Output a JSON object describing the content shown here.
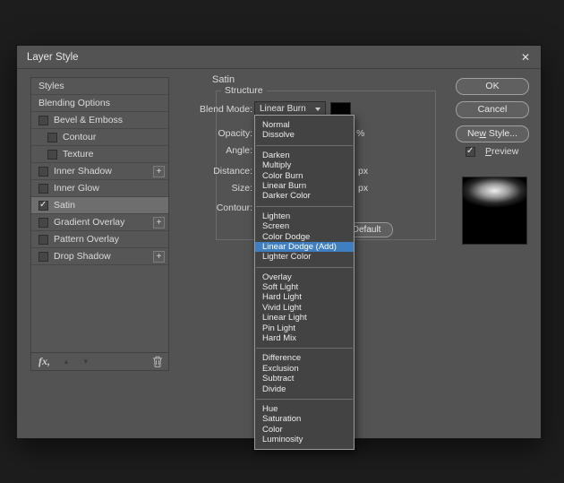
{
  "window": {
    "title": "Layer Style",
    "close_icon": "✕"
  },
  "sidebar": {
    "plus_icon": "+",
    "items": [
      {
        "label": "Styles"
      },
      {
        "label": "Blending Options"
      },
      {
        "label": "Bevel & Emboss"
      },
      {
        "label": "Contour"
      },
      {
        "label": "Texture"
      },
      {
        "label": "Inner Shadow"
      },
      {
        "label": "Inner Glow"
      },
      {
        "label": "Satin"
      },
      {
        "label": "Gradient Overlay"
      },
      {
        "label": "Pattern Overlay"
      },
      {
        "label": "Drop Shadow"
      }
    ],
    "footer": {
      "fx_label": "fx,",
      "up_icon": "▲",
      "down_icon": "▼"
    }
  },
  "panel": {
    "title": "Satin",
    "section": "Structure",
    "blend_mode_label": "Blend Mode:",
    "blend_mode_value": "Linear Burn",
    "opacity_label": "Opacity:",
    "opacity_unit": "%",
    "angle_label": "Angle:",
    "distance_label": "Distance:",
    "distance_unit": "px",
    "size_label": "Size:",
    "size_unit": "px",
    "contour_label": "Contour:",
    "make_default_label": "Make Default"
  },
  "dropdown": {
    "selected_value": "Linear Dodge (Add)",
    "groups": [
      [
        "Normal",
        "Dissolve"
      ],
      [
        "Darken",
        "Multiply",
        "Color Burn",
        "Linear Burn",
        "Darker Color"
      ],
      [
        "Lighten",
        "Screen",
        "Color Dodge",
        "Linear Dodge (Add)",
        "Lighter Color"
      ],
      [
        "Overlay",
        "Soft Light",
        "Hard Light",
        "Vivid Light",
        "Linear Light",
        "Pin Light",
        "Hard Mix"
      ],
      [
        "Difference",
        "Exclusion",
        "Subtract",
        "Divide"
      ],
      [
        "Hue",
        "Saturation",
        "Color",
        "Luminosity"
      ]
    ]
  },
  "actions": {
    "ok": "OK",
    "cancel": "Cancel",
    "new_style_pre": "Ne",
    "new_style_key": "w",
    "new_style_post": " Style...",
    "preview_key": "P",
    "preview_post": "review"
  },
  "colors": {
    "menu_highlight": "#3f7ec0",
    "blend_color_swatch": "#000000"
  }
}
